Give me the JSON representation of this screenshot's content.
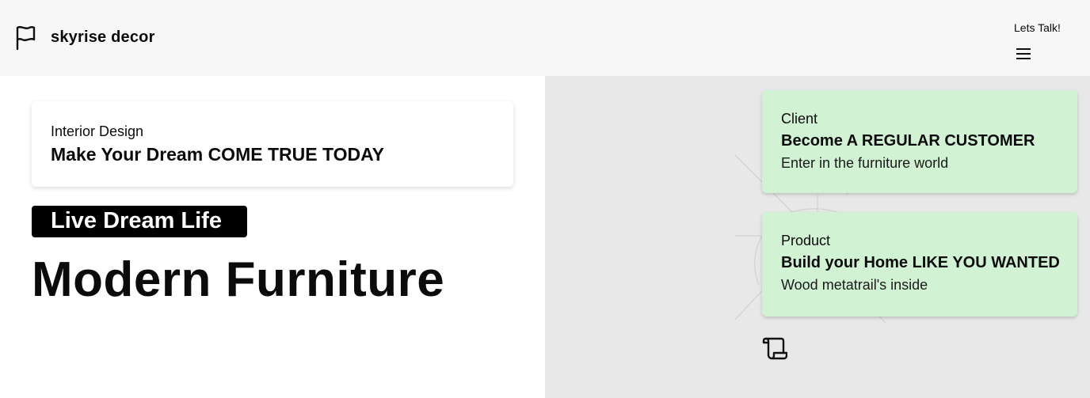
{
  "header": {
    "brand": "skyrise decor",
    "cta": "Lets Talk!",
    "logo_icon": "flag-icon",
    "menu_icon": "hamburger-menu-icon"
  },
  "intro": {
    "subtitle": "Interior Design",
    "title": "Make Your Dream COME TRUE TODAY"
  },
  "badge": "Live Dream Life",
  "hero_title": "Modern Furniture",
  "cards": [
    {
      "label": "Client",
      "title": "Become A REGULAR CUSTOMER",
      "description": "Enter in the furniture world"
    },
    {
      "label": "Product",
      "title": "Build your Home LIKE YOU WANTED",
      "description": "Wood metatrail's inside"
    }
  ],
  "footer_icon": "scroll-icon",
  "colors": {
    "header_bg": "#f7f7f7",
    "right_panel_bg": "#e8e8e8",
    "card_bg": "#d1f2d3",
    "badge_bg": "#000000"
  }
}
